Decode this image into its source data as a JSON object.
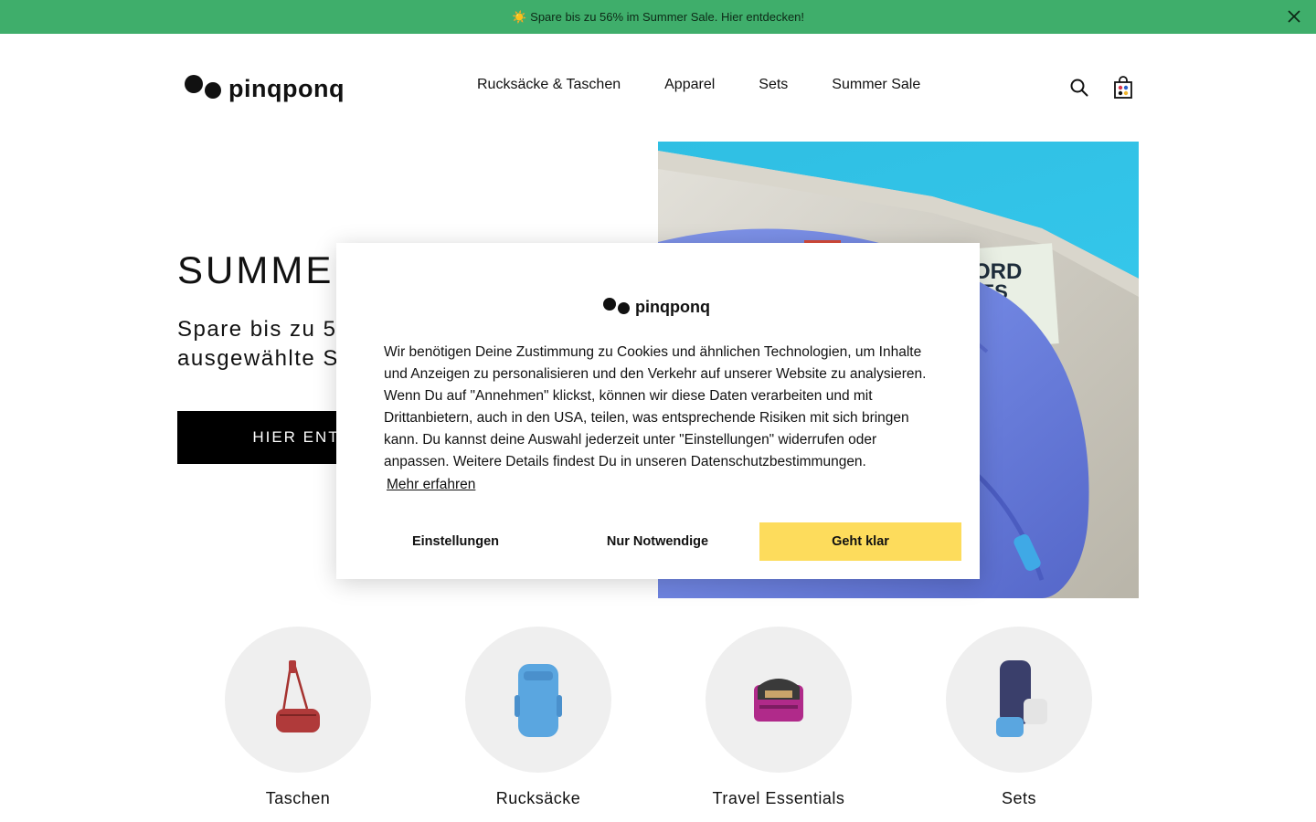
{
  "announcement": {
    "icon": "sun-icon",
    "text": "Spare bis zu 56% im Summer Sale. Hier entdecken!",
    "background": "#3fae6b"
  },
  "header": {
    "logo_text": "pinqponq",
    "nav": [
      {
        "label": "Rucksäcke & Taschen"
      },
      {
        "label": "Apparel"
      },
      {
        "label": "Sets"
      },
      {
        "label": "Summer Sale"
      }
    ]
  },
  "hero": {
    "title": "SUMMER",
    "subtitle_line1": "Spare bis zu 5",
    "subtitle_line2": "ausgewählte S",
    "button_label": "HIER ENT"
  },
  "categories": [
    {
      "label": "Taschen",
      "icon": "sling-bag-icon",
      "color": "#b03a3a"
    },
    {
      "label": "Rucksäcke",
      "icon": "backpack-icon",
      "color": "#5aa6e0"
    },
    {
      "label": "Travel Essentials",
      "icon": "pouch-icon",
      "color": "#b02a8a"
    },
    {
      "label": "Sets",
      "icon": "set-icon",
      "color": "#3a3f6b"
    }
  ],
  "cookie_modal": {
    "logo_text": "pinqponq",
    "body": "Wir benötigen Deine Zustimmung zu Cookies und ähnlichen Technologien, um Inhalte und Anzeigen zu personalisieren und den Verkehr auf unserer Website zu analysieren. Wenn Du auf \"Annehmen\" klickst, können wir diese Daten verarbeiten und mit Drittanbietern, auch in den USA, teilen, was entsprechende Risiken mit sich bringen kann. Du kannst deine Auswahl jederzeit unter \"Einstellungen\" widerrufen oder anpassen. Weitere Details findest Du in unseren Datenschutzbestimmungen.",
    "link_label": "Mehr erfahren",
    "buttons": {
      "settings": "Einstellungen",
      "necessary": "Nur Notwendige",
      "accept": "Geht klar"
    },
    "accept_color": "#fddc5c"
  }
}
